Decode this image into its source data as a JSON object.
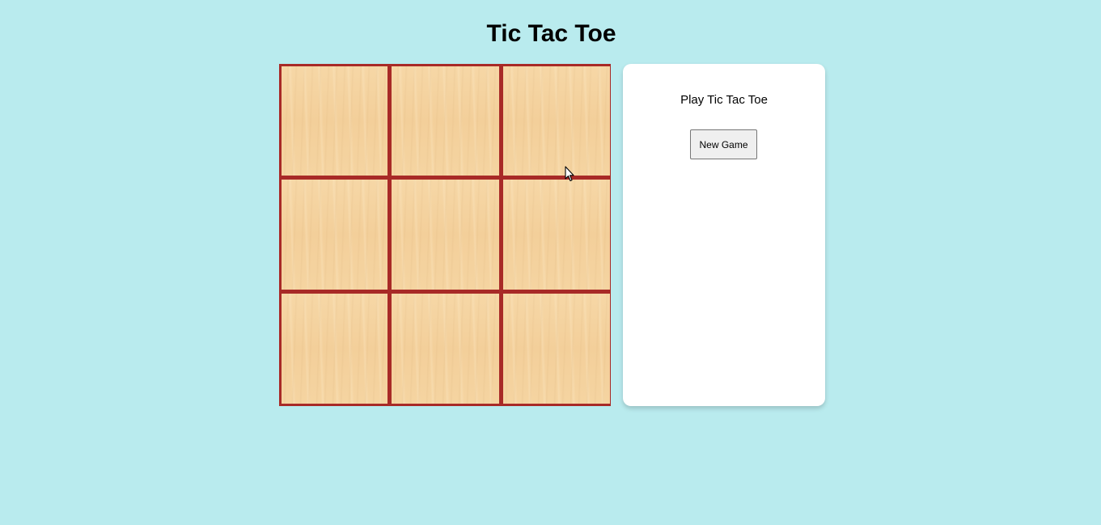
{
  "page": {
    "title": "Tic Tac Toe"
  },
  "board": {
    "rows": 3,
    "cols": 3,
    "cells": [
      "",
      "",
      "",
      "",
      "",
      "",
      "",
      "",
      ""
    ],
    "colors": {
      "grid_line": "#a82a27",
      "cell_wood": "#f4d29e"
    }
  },
  "panel": {
    "status_text": "Play Tic Tac Toe",
    "new_game_label": "New Game"
  },
  "theme": {
    "background": "#b9ebee",
    "panel_background": "#ffffff"
  },
  "pointer": {
    "icon": "mouse-pointer-icon"
  }
}
